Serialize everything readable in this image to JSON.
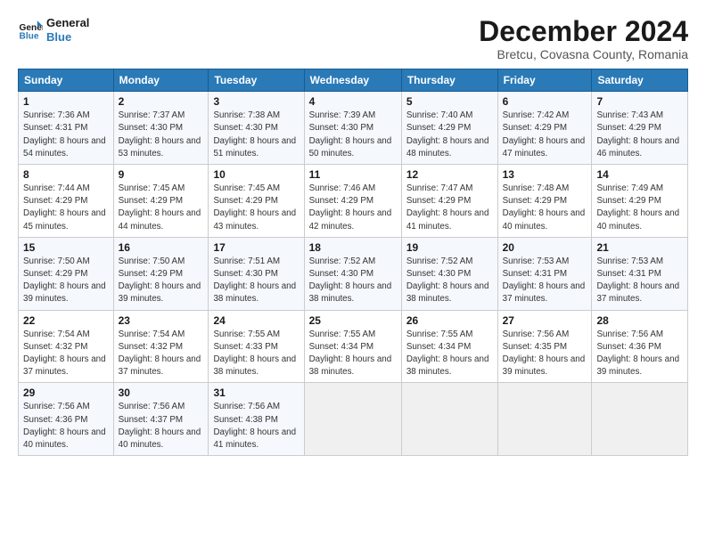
{
  "logo": {
    "line1": "General",
    "line2": "Blue"
  },
  "title": "December 2024",
  "subtitle": "Bretcu, Covasna County, Romania",
  "weekdays": [
    "Sunday",
    "Monday",
    "Tuesday",
    "Wednesday",
    "Thursday",
    "Friday",
    "Saturday"
  ],
  "weeks": [
    [
      {
        "day": 1,
        "sunrise": "7:36 AM",
        "sunset": "4:31 PM",
        "daylight": "8 hours and 54 minutes."
      },
      {
        "day": 2,
        "sunrise": "7:37 AM",
        "sunset": "4:30 PM",
        "daylight": "8 hours and 53 minutes."
      },
      {
        "day": 3,
        "sunrise": "7:38 AM",
        "sunset": "4:30 PM",
        "daylight": "8 hours and 51 minutes."
      },
      {
        "day": 4,
        "sunrise": "7:39 AM",
        "sunset": "4:30 PM",
        "daylight": "8 hours and 50 minutes."
      },
      {
        "day": 5,
        "sunrise": "7:40 AM",
        "sunset": "4:29 PM",
        "daylight": "8 hours and 48 minutes."
      },
      {
        "day": 6,
        "sunrise": "7:42 AM",
        "sunset": "4:29 PM",
        "daylight": "8 hours and 47 minutes."
      },
      {
        "day": 7,
        "sunrise": "7:43 AM",
        "sunset": "4:29 PM",
        "daylight": "8 hours and 46 minutes."
      }
    ],
    [
      {
        "day": 8,
        "sunrise": "7:44 AM",
        "sunset": "4:29 PM",
        "daylight": "8 hours and 45 minutes."
      },
      {
        "day": 9,
        "sunrise": "7:45 AM",
        "sunset": "4:29 PM",
        "daylight": "8 hours and 44 minutes."
      },
      {
        "day": 10,
        "sunrise": "7:45 AM",
        "sunset": "4:29 PM",
        "daylight": "8 hours and 43 minutes."
      },
      {
        "day": 11,
        "sunrise": "7:46 AM",
        "sunset": "4:29 PM",
        "daylight": "8 hours and 42 minutes."
      },
      {
        "day": 12,
        "sunrise": "7:47 AM",
        "sunset": "4:29 PM",
        "daylight": "8 hours and 41 minutes."
      },
      {
        "day": 13,
        "sunrise": "7:48 AM",
        "sunset": "4:29 PM",
        "daylight": "8 hours and 40 minutes."
      },
      {
        "day": 14,
        "sunrise": "7:49 AM",
        "sunset": "4:29 PM",
        "daylight": "8 hours and 40 minutes."
      }
    ],
    [
      {
        "day": 15,
        "sunrise": "7:50 AM",
        "sunset": "4:29 PM",
        "daylight": "8 hours and 39 minutes."
      },
      {
        "day": 16,
        "sunrise": "7:50 AM",
        "sunset": "4:29 PM",
        "daylight": "8 hours and 39 minutes."
      },
      {
        "day": 17,
        "sunrise": "7:51 AM",
        "sunset": "4:30 PM",
        "daylight": "8 hours and 38 minutes."
      },
      {
        "day": 18,
        "sunrise": "7:52 AM",
        "sunset": "4:30 PM",
        "daylight": "8 hours and 38 minutes."
      },
      {
        "day": 19,
        "sunrise": "7:52 AM",
        "sunset": "4:30 PM",
        "daylight": "8 hours and 38 minutes."
      },
      {
        "day": 20,
        "sunrise": "7:53 AM",
        "sunset": "4:31 PM",
        "daylight": "8 hours and 37 minutes."
      },
      {
        "day": 21,
        "sunrise": "7:53 AM",
        "sunset": "4:31 PM",
        "daylight": "8 hours and 37 minutes."
      }
    ],
    [
      {
        "day": 22,
        "sunrise": "7:54 AM",
        "sunset": "4:32 PM",
        "daylight": "8 hours and 37 minutes."
      },
      {
        "day": 23,
        "sunrise": "7:54 AM",
        "sunset": "4:32 PM",
        "daylight": "8 hours and 37 minutes."
      },
      {
        "day": 24,
        "sunrise": "7:55 AM",
        "sunset": "4:33 PM",
        "daylight": "8 hours and 38 minutes."
      },
      {
        "day": 25,
        "sunrise": "7:55 AM",
        "sunset": "4:34 PM",
        "daylight": "8 hours and 38 minutes."
      },
      {
        "day": 26,
        "sunrise": "7:55 AM",
        "sunset": "4:34 PM",
        "daylight": "8 hours and 38 minutes."
      },
      {
        "day": 27,
        "sunrise": "7:56 AM",
        "sunset": "4:35 PM",
        "daylight": "8 hours and 39 minutes."
      },
      {
        "day": 28,
        "sunrise": "7:56 AM",
        "sunset": "4:36 PM",
        "daylight": "8 hours and 39 minutes."
      }
    ],
    [
      {
        "day": 29,
        "sunrise": "7:56 AM",
        "sunset": "4:36 PM",
        "daylight": "8 hours and 40 minutes."
      },
      {
        "day": 30,
        "sunrise": "7:56 AM",
        "sunset": "4:37 PM",
        "daylight": "8 hours and 40 minutes."
      },
      {
        "day": 31,
        "sunrise": "7:56 AM",
        "sunset": "4:38 PM",
        "daylight": "8 hours and 41 minutes."
      },
      null,
      null,
      null,
      null
    ]
  ]
}
